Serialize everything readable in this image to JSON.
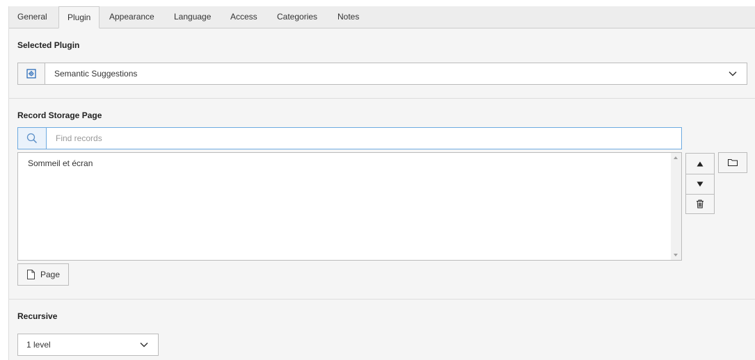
{
  "tabs": [
    {
      "label": "General",
      "active": false
    },
    {
      "label": "Plugin",
      "active": true
    },
    {
      "label": "Appearance",
      "active": false
    },
    {
      "label": "Language",
      "active": false
    },
    {
      "label": "Access",
      "active": false
    },
    {
      "label": "Categories",
      "active": false
    },
    {
      "label": "Notes",
      "active": false
    }
  ],
  "plugin": {
    "section_label": "Selected Plugin",
    "addon_icon": "plugin-icon",
    "selected_value": "Semantic Suggestions"
  },
  "storage": {
    "section_label": "Record Storage Page",
    "search_placeholder": "Find records",
    "search_value": "",
    "records": [
      "Sommeil et écran"
    ],
    "page_button_label": "Page",
    "controls": [
      "move-up-icon",
      "move-down-icon",
      "trash-icon",
      "folder-icon"
    ]
  },
  "recursive": {
    "section_label": "Recursive",
    "selected_value": "1 level"
  },
  "colors": {
    "accent": "#6daae0",
    "icon_blue": "#1a62b5",
    "background": "#f5f5f5",
    "border": "#bbbbbb"
  }
}
